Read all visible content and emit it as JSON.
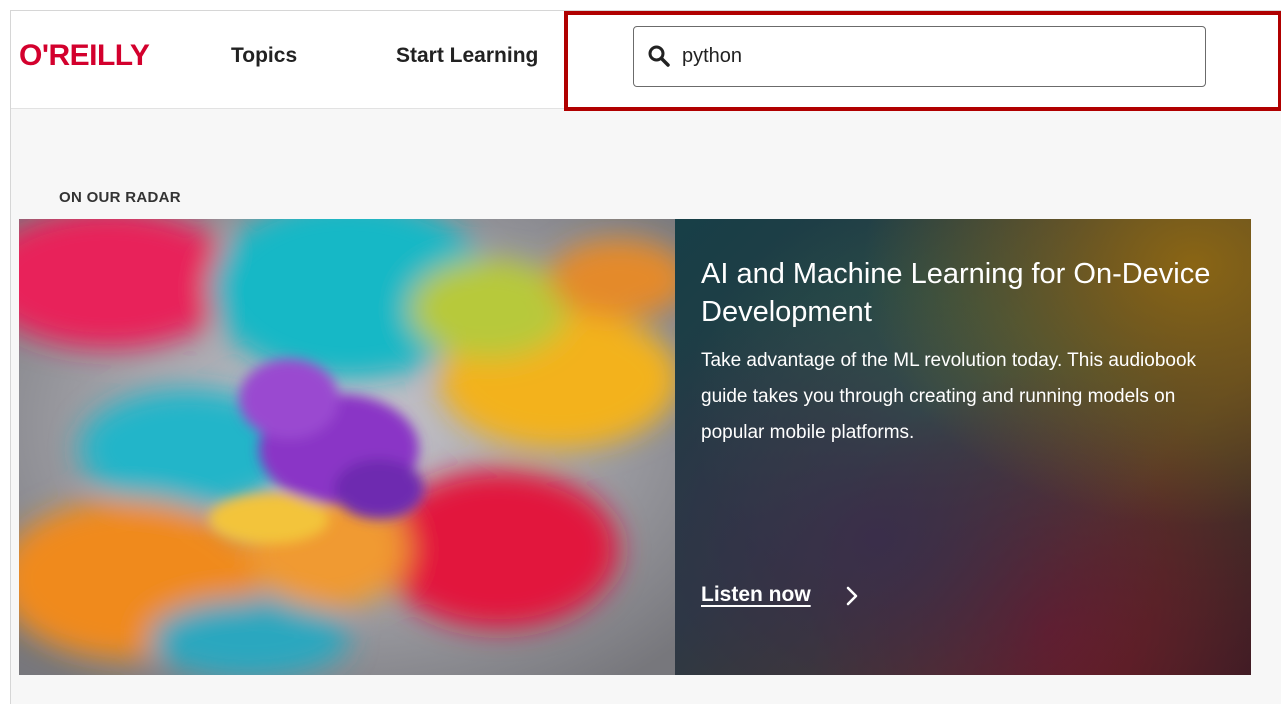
{
  "header": {
    "logo": "O'REILLY",
    "nav": {
      "topics": "Topics",
      "start_learning": "Start Learning"
    },
    "search": {
      "value": "python",
      "icon": "search-icon"
    }
  },
  "radar": {
    "label": "ON OUR RADAR",
    "title": "AI and Machine Learning for On-Device Development",
    "description": "Take advantage of the ML revolution today. This audiobook guide takes you through creating and running models on popular mobile platforms.",
    "cta": "Listen now",
    "cta_icon": "chevron-right-icon"
  },
  "colors": {
    "brand": "#d3002d",
    "highlight": "#b00000"
  }
}
